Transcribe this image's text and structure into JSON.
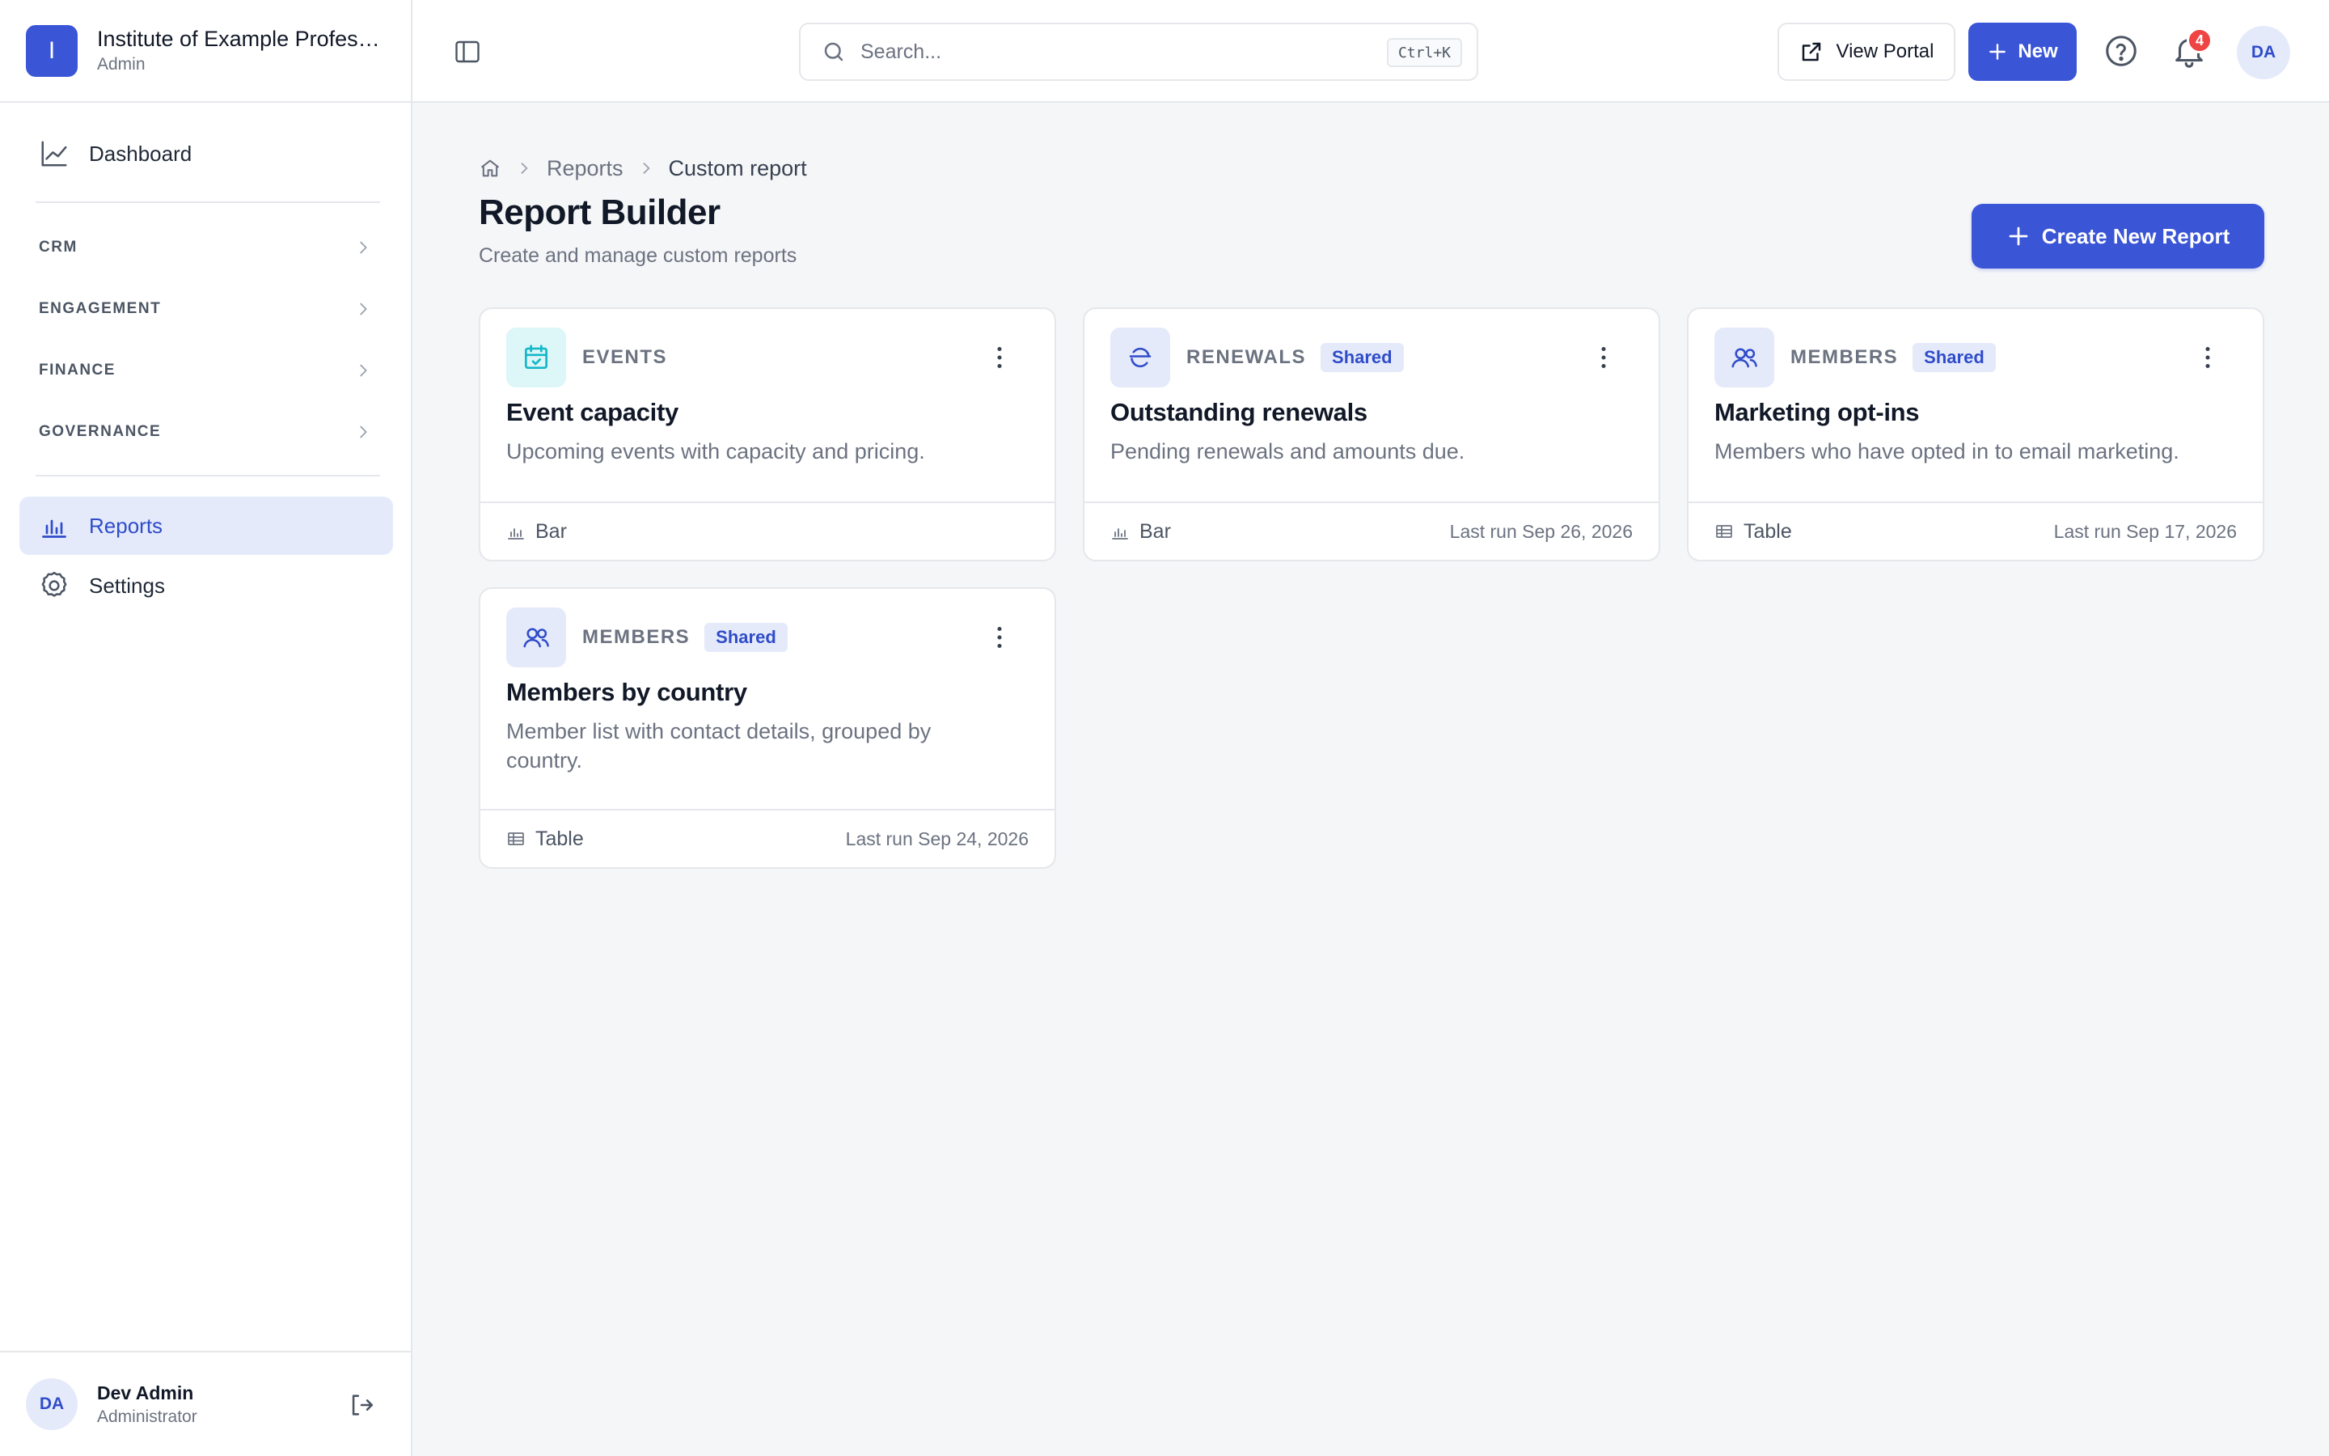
{
  "org": {
    "initial": "I",
    "name": "Institute of Example Professionals",
    "role": "Admin"
  },
  "nav": {
    "dashboard": "Dashboard",
    "groups": [
      "CRM",
      "ENGAGEMENT",
      "FINANCE",
      "GOVERNANCE"
    ],
    "reports": "Reports",
    "settings": "Settings",
    "active": "Reports"
  },
  "user": {
    "initials": "DA",
    "name": "Dev Admin",
    "role": "Administrator"
  },
  "topbar": {
    "search_placeholder": "Search...",
    "search_shortcut": "Ctrl+K",
    "view_portal": "View Portal",
    "new": "New",
    "notification_count": "4",
    "avatar_initials": "DA"
  },
  "breadcrumb": {
    "reports": "Reports",
    "current": "Custom report"
  },
  "page": {
    "title": "Report Builder",
    "subtitle": "Create and manage custom reports",
    "create_button": "Create New Report"
  },
  "cards": [
    {
      "category": "EVENTS",
      "shared": false,
      "title": "Event capacity",
      "description": "Upcoming events with capacity and pricing.",
      "type": "Bar",
      "last_run": "",
      "icon": "calendar-icon"
    },
    {
      "category": "RENEWALS",
      "shared": true,
      "shared_label": "Shared",
      "title": "Outstanding renewals",
      "description": "Pending renewals and amounts due.",
      "type": "Bar",
      "last_run": "Last run Sep 26, 2026",
      "icon": "refresh-icon"
    },
    {
      "category": "MEMBERS",
      "shared": true,
      "shared_label": "Shared",
      "title": "Marketing opt-ins",
      "description": "Members who have opted in to email marketing.",
      "type": "Table",
      "last_run": "Last run Sep 17, 2026",
      "icon": "users-icon"
    },
    {
      "category": "MEMBERS",
      "shared": true,
      "shared_label": "Shared",
      "title": "Members by country",
      "description": "Member list with contact details, grouped by country.",
      "type": "Table",
      "last_run": "Last run Sep 24, 2026",
      "icon": "users-icon"
    }
  ],
  "colors": {
    "primary": "#3a55d6",
    "active_bg": "#e5eafb",
    "badge": "#ef4444",
    "events_icon_bg": "#ddf6f8",
    "events_icon": "#14b8c8"
  }
}
